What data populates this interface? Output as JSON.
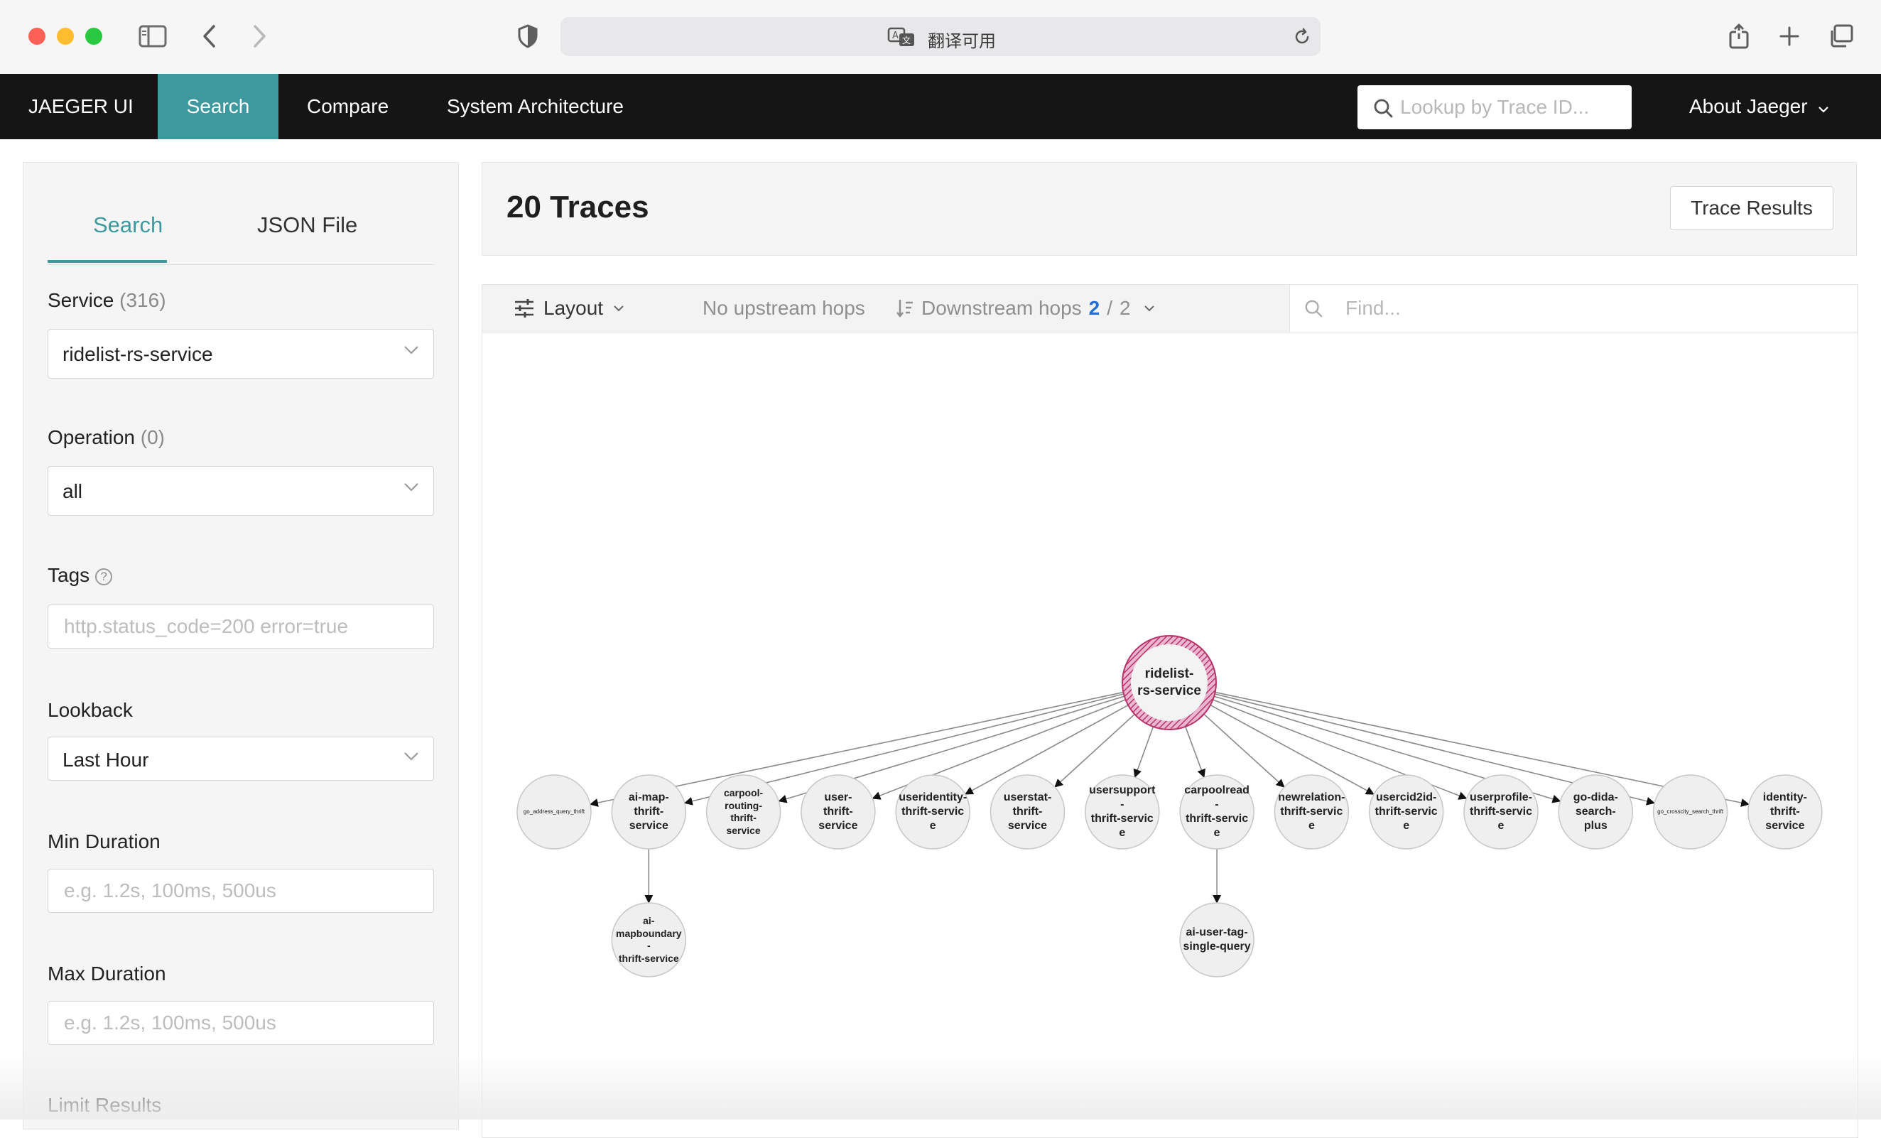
{
  "browser": {
    "address_text": "翻译可用",
    "icons": [
      "sidebar-toggle-icon",
      "back-icon",
      "forward-icon",
      "shield-icon",
      "translate-icon",
      "reload-icon",
      "share-icon",
      "new-tab-icon",
      "tabs-overview-icon"
    ]
  },
  "nav": {
    "brand": "JAEGER UI",
    "items": [
      {
        "label": "Search",
        "active": true
      },
      {
        "label": "Compare"
      },
      {
        "label": "System Architecture"
      }
    ],
    "lookup_placeholder": "Lookup by Trace ID...",
    "about": "About Jaeger"
  },
  "search_panel": {
    "tabs": [
      "Search",
      "JSON File"
    ],
    "service": {
      "label": "Service",
      "count": "(316)",
      "value": "ridelist-rs-service"
    },
    "operation": {
      "label": "Operation",
      "count": "(0)",
      "value": "all"
    },
    "tags": {
      "label": "Tags",
      "help": "?",
      "placeholder": "http.status_code=200 error=true"
    },
    "lookback": {
      "label": "Lookback",
      "value": "Last Hour"
    },
    "min_duration": {
      "label": "Min Duration",
      "placeholder": "e.g. 1.2s, 100ms, 500us"
    },
    "max_duration": {
      "label": "Max Duration",
      "placeholder": "e.g. 1.2s, 100ms, 500us"
    },
    "limit": {
      "label": "Limit Results"
    }
  },
  "results": {
    "title": "20 Traces",
    "trace_results_button": "Trace Results"
  },
  "graph_toolbar": {
    "layout": "Layout",
    "upstream": "No upstream hops",
    "downstream_label": "Downstream hops",
    "downstream_current": "2",
    "downstream_sep": "/",
    "downstream_total": "2",
    "find_placeholder": "Find..."
  },
  "dag": {
    "root": {
      "id": "root",
      "label": "ridelist-rs-service",
      "lines": [
        "ridelist-",
        "rs-service"
      ]
    },
    "children": [
      {
        "id": "c1",
        "label": "go_address_query_thrift",
        "lines": [
          "go_address_query_thrift"
        ],
        "tiny": true
      },
      {
        "id": "c2",
        "label": "ai-map-thrift-service",
        "lines": [
          "ai-map-",
          "thrift-",
          "service"
        ]
      },
      {
        "id": "c3",
        "label": "carpool-routing-thrift-service",
        "lines": [
          "carpool-",
          "routing-",
          "thrift-",
          "service"
        ],
        "small": true
      },
      {
        "id": "c4",
        "label": "user-thrift-service",
        "lines": [
          "user-",
          "thrift-",
          "service"
        ]
      },
      {
        "id": "c5",
        "label": "useridentity-thrift-service",
        "lines": [
          "useridentity-",
          "thrift-service"
        ]
      },
      {
        "id": "c6",
        "label": "userstat-thrift-service",
        "lines": [
          "userstat-",
          "thrift-",
          "service"
        ]
      },
      {
        "id": "c7",
        "label": "usersupport-thrift-service",
        "lines": [
          "usersupport-",
          "thrift-service"
        ]
      },
      {
        "id": "c8",
        "label": "carpoolread-thrift-service",
        "lines": [
          "carpoolread-",
          "thrift-service"
        ]
      },
      {
        "id": "c9",
        "label": "newrelation-thrift-service",
        "lines": [
          "newrelation-",
          "thrift-service"
        ]
      },
      {
        "id": "c10",
        "label": "usercid2id-thrift-service",
        "lines": [
          "usercid2id-",
          "thrift-service"
        ]
      },
      {
        "id": "c11",
        "label": "userprofile-thrift-service",
        "lines": [
          "userprofile-",
          "thrift-service"
        ]
      },
      {
        "id": "c12",
        "label": "go-dida-search-plus",
        "lines": [
          "go-dida-",
          "search-",
          "plus"
        ]
      },
      {
        "id": "c13",
        "label": "go_crosscity_search_thrift",
        "lines": [
          "go_crosscity_search_thrift"
        ],
        "tiny": true
      },
      {
        "id": "c14",
        "label": "identity-thrift-service",
        "lines": [
          "identity-",
          "thrift-",
          "service"
        ]
      }
    ],
    "grandchildren": [
      {
        "id": "g1",
        "parent": "c2",
        "label": "ai-mapboundary-thrift-service",
        "lines": [
          "ai-",
          "mapboundary-",
          "thrift-service"
        ],
        "small": true
      },
      {
        "id": "g2",
        "parent": "c8",
        "label": "ai-user-tag-single-query",
        "lines": [
          "ai-user-tag-",
          "single-query"
        ]
      }
    ]
  }
}
